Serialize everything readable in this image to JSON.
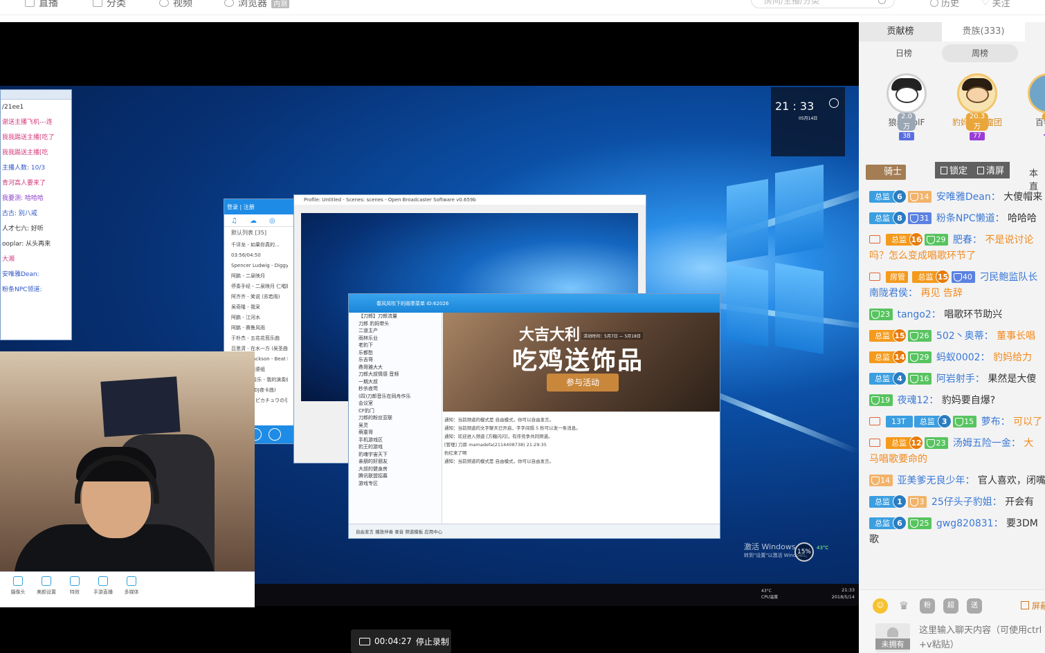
{
  "topnav": {
    "items": [
      {
        "label": "直播"
      },
      {
        "label": "分类"
      },
      {
        "label": "视频"
      },
      {
        "label": "浏览器",
        "badge": "内测"
      }
    ],
    "search_placeholder": "房间/主播/分类",
    "history_label": "历史",
    "follow_label": "关注"
  },
  "stream": {
    "clock_time": "21 : 33",
    "clock_date": "05月14日",
    "taskbar_time": "21:33",
    "taskbar_date": "2018/5/14",
    "taskbar_temp": "43°C",
    "taskbar_temp_label": "CPU温度",
    "activate_title": "激活 Windows",
    "activate_sub": "转到\"设置\"以激活 Windows。",
    "cpu_percent": "15%",
    "cpu_temp": "43°C",
    "record_time": "00:04:27",
    "record_stop": "停止录制",
    "obs_title": "Profile: Untitled - Scenes: scenes - Open Broadcaster Software v0.659b",
    "music_head": "登录 | 注册",
    "music_list_title": "默认列表 [35]",
    "music_tracks": [
      "千评龙 - 如果你真的...",
      "03:56/04:50",
      "Spencer Ludwig - Diggy (RA",
      "阿鹏 - 二泉映月",
      "停奏手经 - 二泉映月 仁唱她撞",
      "阿齐齐 - 笑说 (苏若雨)",
      "吴奇隆 - 我采",
      "阿鹏 - 江河水",
      "阿鹏 - 赛鲁风雨",
      "于朴杰 - 五花花苞乐曲",
      "吕思清 - 在水一方 (吴圣曲)",
      "Michael Jackson - Beat It",
      "陈慧琳 - 湿婆组",
      "约瑟喵 音奏乐 - 我的演奏组",
      "DJ - 阿洒 (DJ夜卡曲)",
      "大吉普江 - ピカチュウの引..."
    ],
    "yy_title": "春风风吹下的雨季菜单  ID:62026",
    "banner_small": "大吉大利",
    "banner_big": "吃鸡送饰品",
    "banner_date": "活动时间：5月7日 — 5月18日",
    "banner_button": "参与活动",
    "yy_msgs": [
      "通知：当前频道的模式是 自由模式，你可以自由发言。",
      "通知：当前频道的文字聊天已开启，字字间隔 5 秒可以发一条消息。",
      "通知：欢迎进入频道 [方糖闪闪]，有序竞争共同频道。",
      "[管理] 刀郎 mamadefa(2114408738) 21:29:35",
      "豹红来了啊",
      "通知：当前频道的模式是 自由模式，你可以自由发言。"
    ],
    "yy_tree": [
      "【刀郎】刀郎流量",
      "刀郎 豹妈带头",
      "二道主产",
      "雨林乐业",
      "老豹下",
      "乐都愁",
      "乐吉哥",
      "鼎哥雅大大",
      "刀郎大叔情感 音频",
      "一期大叔",
      "秒杀夜莺",
      "(四)刀郎音乐在同舟作乐",
      "会议室",
      "CF豹门",
      "刀郎的粉丝亚联",
      "吴灵",
      "萌童哥",
      "手机游戏区",
      "豹王的游戏",
      "豹魂宇宙天下",
      "亲朋的好朋友",
      "大叔的健身房",
      "腾讯联盟招募",
      "游戏专区"
    ],
    "yy_bottom": "自由发言   播放伴奏   录音   频道模板   应用中心",
    "yybar_buttons": [
      "摄像头",
      "美颜设置",
      "特效",
      "手游直播",
      "多媒体"
    ],
    "chat_lines": [
      {
        "text": "/21ee1",
        "cls": ""
      },
      {
        "text": "谢送主播飞机---连",
        "cls": "c-pink"
      },
      {
        "text": "我我踢送主播[吃了",
        "cls": "c-pink"
      },
      {
        "text": "我我踢送主播[吃",
        "cls": "c-pink"
      },
      {
        "text": "主播人数: 10/3",
        "cls": "c-blue"
      },
      {
        "text": "青河高人要来了",
        "cls": "c-pink"
      },
      {
        "text": "我要测: 哈哈哈",
        "cls": "c-purple"
      },
      {
        "text": "古古: 别八戒",
        "cls": "c-blue"
      },
      {
        "text": "人才七六: 好听",
        "cls": ""
      },
      {
        "text": "ooplar: 从头再来",
        "cls": ""
      },
      {
        "text": "大湘",
        "cls": "c-pink"
      },
      {
        "text": "安唯雅Dean:",
        "cls": "c-blue"
      },
      {
        "text": "粉条NPC领道:",
        "cls": "c-blue"
      }
    ]
  },
  "sidebar": {
    "tabs": [
      "贡献榜",
      "贵族(333)"
    ],
    "subtabs": [
      "日榜",
      "周榜"
    ],
    "ranks": [
      {
        "name": "狼叔WolF",
        "value": "2.0万",
        "level": "38"
      },
      {
        "name": "豹妈丶毒瘤团",
        "value": "20.3万",
        "level": "77"
      },
      {
        "name": "百特千",
        "value": "2",
        "level": ""
      }
    ],
    "knight_label": "骑士",
    "lock_label": "锁定",
    "clear_label": "清屏",
    "behind_text": "本直",
    "messages": [
      {
        "tv": false,
        "badges": [
          {
            "t": "zong",
            "n": "6"
          },
          {
            "t": "orange",
            "n": "14"
          }
        ],
        "user": "安唯雅Dean：",
        "text": "大傻帽来",
        "wrap": false,
        "textcls": "text-dark"
      },
      {
        "tv": false,
        "badges": [
          {
            "t": "zong",
            "n": "8"
          },
          {
            "t": "blue",
            "n": "31"
          }
        ],
        "user": "粉条NPC懒道：",
        "text": "哈哈哈",
        "wrap": false,
        "textcls": "text-dark"
      },
      {
        "tv": true,
        "badges": [
          {
            "t": "zonggold",
            "n": "16"
          },
          {
            "t": "green",
            "n": "29"
          }
        ],
        "user": "肥春：",
        "text": "不是说讨论吗？怎么变成唱歌环节了",
        "wrap": true,
        "textcls": "text-orange"
      },
      {
        "tv": true,
        "badges": [
          {
            "t": "fang",
            "n": "房管"
          },
          {
            "t": "zonggold",
            "n": "15"
          },
          {
            "t": "blue",
            "n": "40"
          }
        ],
        "user": "刁民鲍监队长南陇君侯：",
        "text": "再见 告辞",
        "wrap": true,
        "textcls": "text-orange"
      },
      {
        "tv": false,
        "badges": [
          {
            "t": "green",
            "n": "23"
          }
        ],
        "user": "tango2：",
        "text": "唱歌环节助兴",
        "wrap": false,
        "textcls": "text-dark"
      },
      {
        "tv": false,
        "badges": [
          {
            "t": "zonggold",
            "n": "15"
          },
          {
            "t": "green",
            "n": "26"
          }
        ],
        "user": "502丶奥蒂：",
        "text": "董事长唱",
        "wrap": false,
        "textcls": "text-orange"
      },
      {
        "tv": false,
        "badges": [
          {
            "t": "zonggold",
            "n": "14"
          },
          {
            "t": "green",
            "n": "29"
          }
        ],
        "user": "蚂蚁0002：",
        "text": "豹妈给力",
        "wrap": false,
        "textcls": "text-orange"
      },
      {
        "tv": false,
        "badges": [
          {
            "t": "zong",
            "n": "4"
          },
          {
            "t": "green",
            "n": "16"
          }
        ],
        "user": "阿岩射手：",
        "text": "果然是大傻",
        "wrap": false,
        "textcls": "text-dark"
      },
      {
        "tv": false,
        "badges": [
          {
            "t": "green",
            "n": "19"
          }
        ],
        "user": "夜魂12：",
        "text": "豹妈要自爆?",
        "wrap": false,
        "textcls": "text-dark"
      },
      {
        "tv": true,
        "badges": [
          {
            "t": "zong",
            "n": "3",
            "pre": "13T"
          },
          {
            "t": "green",
            "n": "15"
          }
        ],
        "user": "萝布：",
        "text": "可以了",
        "wrap": false,
        "textcls": "text-orange"
      },
      {
        "tv": true,
        "badges": [
          {
            "t": "zonggold",
            "n": "12"
          },
          {
            "t": "green",
            "n": "23"
          }
        ],
        "user": "汤姆五险一金：",
        "text": "大马唱歌要命的",
        "wrap": true,
        "textcls": "text-orange"
      },
      {
        "tv": false,
        "badges": [
          {
            "t": "orange",
            "n": "14"
          }
        ],
        "user": "亚美爹无良少年：",
        "text": "官人喜欢，闭嘴",
        "wrap": false,
        "textcls": "text-dark"
      },
      {
        "tv": false,
        "badges": [
          {
            "t": "zong",
            "n": "1"
          },
          {
            "t": "orange",
            "n": "3"
          }
        ],
        "user": "25仔头子豹姐：",
        "text": "开会有",
        "wrap": false,
        "textcls": "text-dark"
      },
      {
        "tv": false,
        "badges": [
          {
            "t": "zong",
            "n": "6"
          },
          {
            "t": "green",
            "n": "25"
          }
        ],
        "user": "gwg820831：",
        "text": "要3DM歌",
        "wrap": true,
        "textcls": "text-dark"
      }
    ],
    "danmu_label": "屏蔽",
    "no_badge": "未拥有",
    "input_placeholder": "这里输入聊天内容（可使用ctrl +v粘贴）",
    "emotes": [
      "粉",
      "超",
      "送"
    ]
  },
  "colors": {
    "accent": "#3a78d6",
    "orange": "#f38a1c",
    "green": "#58c460"
  }
}
